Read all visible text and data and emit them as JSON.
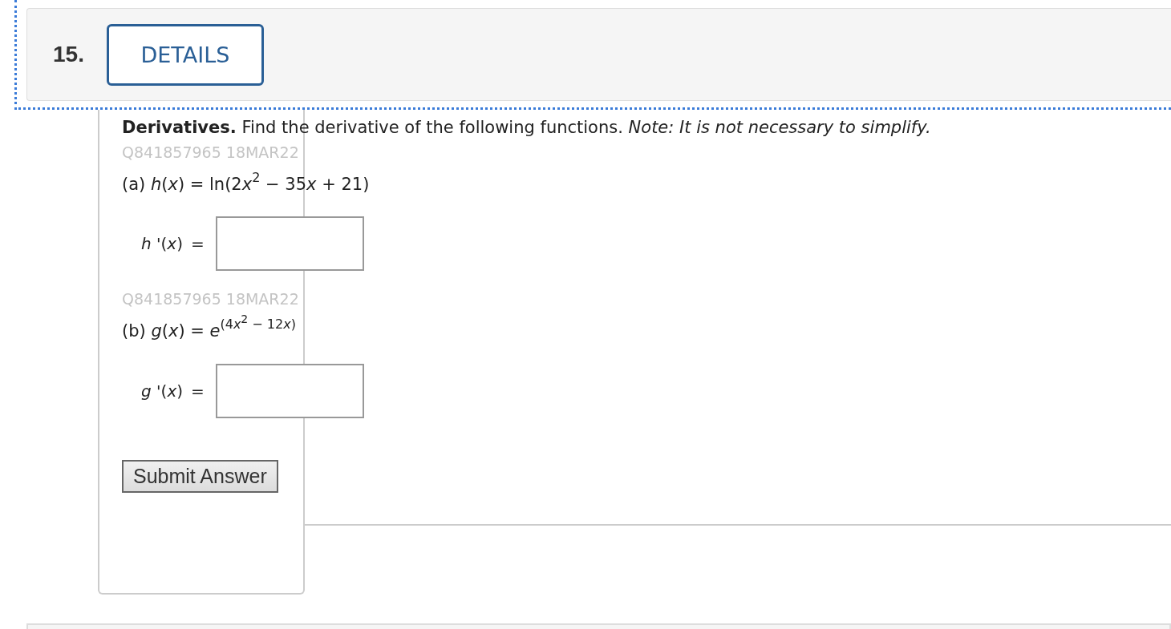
{
  "question": {
    "number": "15.",
    "details_button": "DETAILS"
  },
  "instructions": "**Derivatives.** Find the derivative of the following functions. *Note: It is not necessary to simplify.*",
  "parts": [
    {
      "id_code": "Q841857965 18MAR22",
      "function": [
        {
          "kind": "plain",
          "text": "(a) "
        },
        {
          "kind": "italic",
          "text": "h"
        },
        {
          "kind": "plain",
          "text": "("
        },
        {
          "kind": "italic",
          "text": "x"
        },
        {
          "kind": "plain",
          "text": ") = ln(2"
        },
        {
          "kind": "italic",
          "text": "x"
        },
        {
          "kind": "sup",
          "text": "2"
        },
        {
          "kind": "plain",
          "text": " − 35"
        },
        {
          "kind": "italic",
          "text": "x"
        },
        {
          "kind": "plain",
          "text": " + 21)"
        }
      ],
      "answer_label": [
        {
          "kind": "italic",
          "text": "h"
        },
        {
          "kind": "plain",
          "text": " '("
        },
        {
          "kind": "italic",
          "text": "x"
        },
        {
          "kind": "plain",
          "text": ")"
        }
      ],
      "equals": "="
    },
    {
      "id_code": "Q841857965 18MAR22",
      "function": [
        {
          "kind": "plain",
          "text": "(b) "
        },
        {
          "kind": "italic",
          "text": "g"
        },
        {
          "kind": "plain",
          "text": "("
        },
        {
          "kind": "italic",
          "text": "x"
        },
        {
          "kind": "plain",
          "text": ") = "
        },
        {
          "kind": "italic",
          "text": "e"
        },
        {
          "kind": "sup",
          "text": "(4"
        },
        {
          "kind": "sup-italic",
          "text": "x"
        },
        {
          "kind": "sup-sup",
          "text": "2"
        },
        {
          "kind": "sup",
          "text": " − 12"
        },
        {
          "kind": "sup-italic",
          "text": "x"
        },
        {
          "kind": "sup",
          "text": ")"
        }
      ],
      "answer_label": [
        {
          "kind": "italic",
          "text": "g"
        },
        {
          "kind": "plain",
          "text": " '("
        },
        {
          "kind": "italic",
          "text": "x"
        },
        {
          "kind": "plain",
          "text": ")"
        }
      ],
      "equals": "="
    }
  ],
  "submit_button": "Submit Answer"
}
